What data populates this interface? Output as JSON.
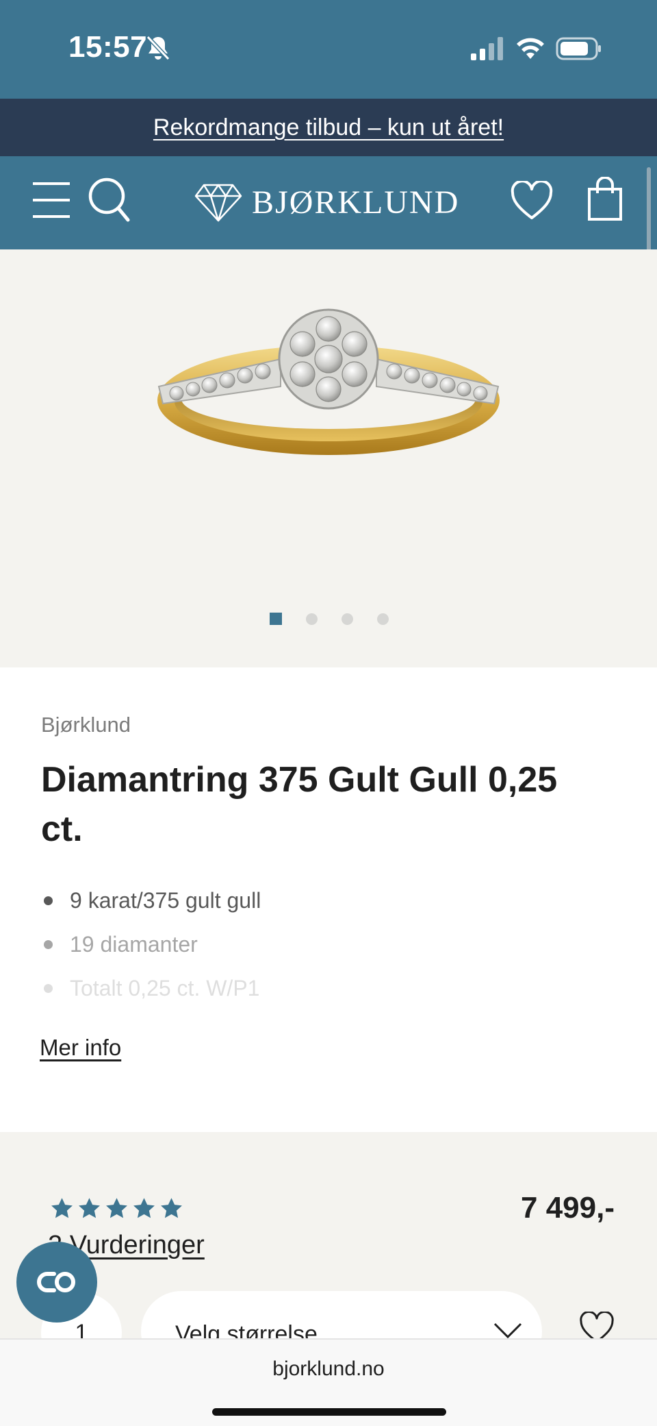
{
  "status_bar": {
    "time": "15:57",
    "icons": [
      "bell-slash-icon",
      "signal-icon",
      "wifi-icon",
      "battery-icon"
    ]
  },
  "promo": {
    "text": "Rekordmange tilbud – kun ut året!"
  },
  "header": {
    "logo_text": "BJØRKLUND",
    "icons": [
      "menu-icon",
      "search-icon",
      "diamond-logo-icon",
      "heart-icon",
      "bag-icon"
    ]
  },
  "gallery": {
    "image": "diamond-ring-image",
    "slide_count": 4,
    "active_slide": 1
  },
  "product": {
    "brand": "Bjørklund",
    "title": "Diamantring 375 Gult Gull 0,25 ct.",
    "features": [
      "9 karat/375 gult gull",
      "19 diamanter",
      "Totalt 0,25 ct. W/P1"
    ],
    "more_info_label": "Mer info"
  },
  "purchase": {
    "rating": 5,
    "rating_max": 5,
    "reviews_label": "2 Vurderinger",
    "price": "7 499,-",
    "quantity": "1",
    "size_placeholder": "Velg størrelse"
  },
  "browser": {
    "url": "bjorklund.no"
  },
  "colors": {
    "brand_blue": "#3d7591",
    "banner_navy": "#2b3c54",
    "gallery_bg": "#f4f3ef"
  }
}
